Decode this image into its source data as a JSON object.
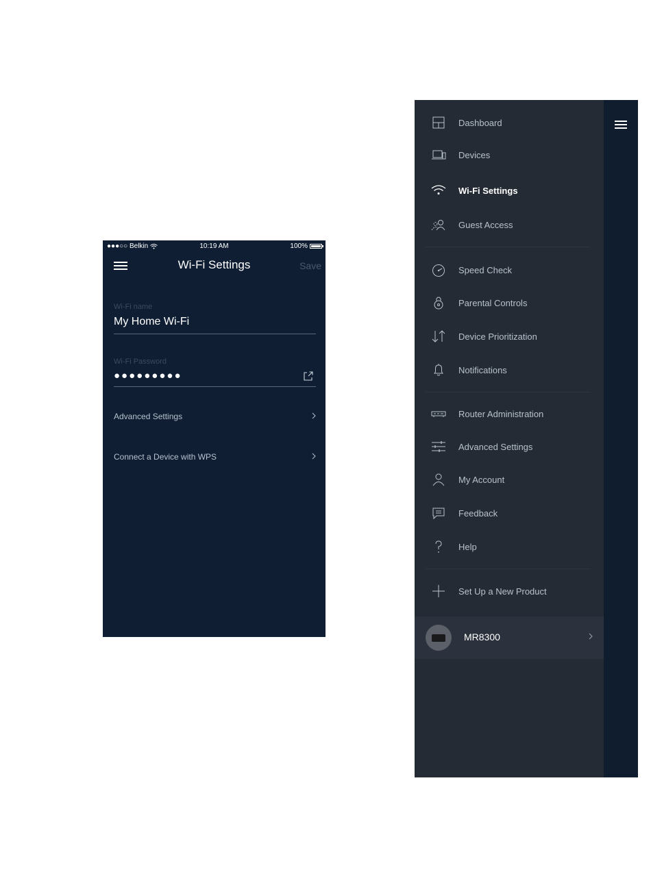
{
  "phone": {
    "status_bar": {
      "carrier": "●●●○○ Belkin",
      "time": "10:19 AM",
      "battery": "100%"
    },
    "title": "Wi-Fi Settings",
    "save_label": "Save",
    "wifi_name": {
      "label": "Wi-Fi name",
      "value": "My Home Wi-Fi"
    },
    "wifi_password": {
      "label": "Wi-Fi Password",
      "value": "●●●●●●●●●"
    },
    "rows": [
      {
        "label": "Advanced Settings"
      },
      {
        "label": "Connect a Device with WPS"
      }
    ]
  },
  "drawer": {
    "items": [
      {
        "label": "Dashboard",
        "icon": "dashboard-icon"
      },
      {
        "label": "Devices",
        "icon": "devices-icon"
      },
      {
        "label": "Wi-Fi Settings",
        "icon": "wifi-icon",
        "active": true
      },
      {
        "label": "Guest Access",
        "icon": "guest-access-icon"
      },
      {
        "label": "Speed Check",
        "icon": "speedometer-icon"
      },
      {
        "label": "Parental Controls",
        "icon": "parental-controls-icon"
      },
      {
        "label": "Device Prioritization",
        "icon": "prioritization-arrows-icon"
      },
      {
        "label": "Notifications",
        "icon": "bell-icon"
      },
      {
        "label": "Router Administration",
        "icon": "router-icon"
      },
      {
        "label": "Advanced Settings",
        "icon": "sliders-icon"
      },
      {
        "label": "My Account",
        "icon": "user-icon"
      },
      {
        "label": "Feedback",
        "icon": "chat-icon"
      },
      {
        "label": "Help",
        "icon": "question-icon"
      },
      {
        "label": "Set Up a New Product",
        "icon": "plus-icon"
      }
    ],
    "device": {
      "name": "MR8300"
    }
  },
  "colors": {
    "phone_bg": "#0f1e33",
    "drawer_bg": "#242b35",
    "drawer_strip": "#101d2e",
    "accent_text": "#ffffff"
  }
}
